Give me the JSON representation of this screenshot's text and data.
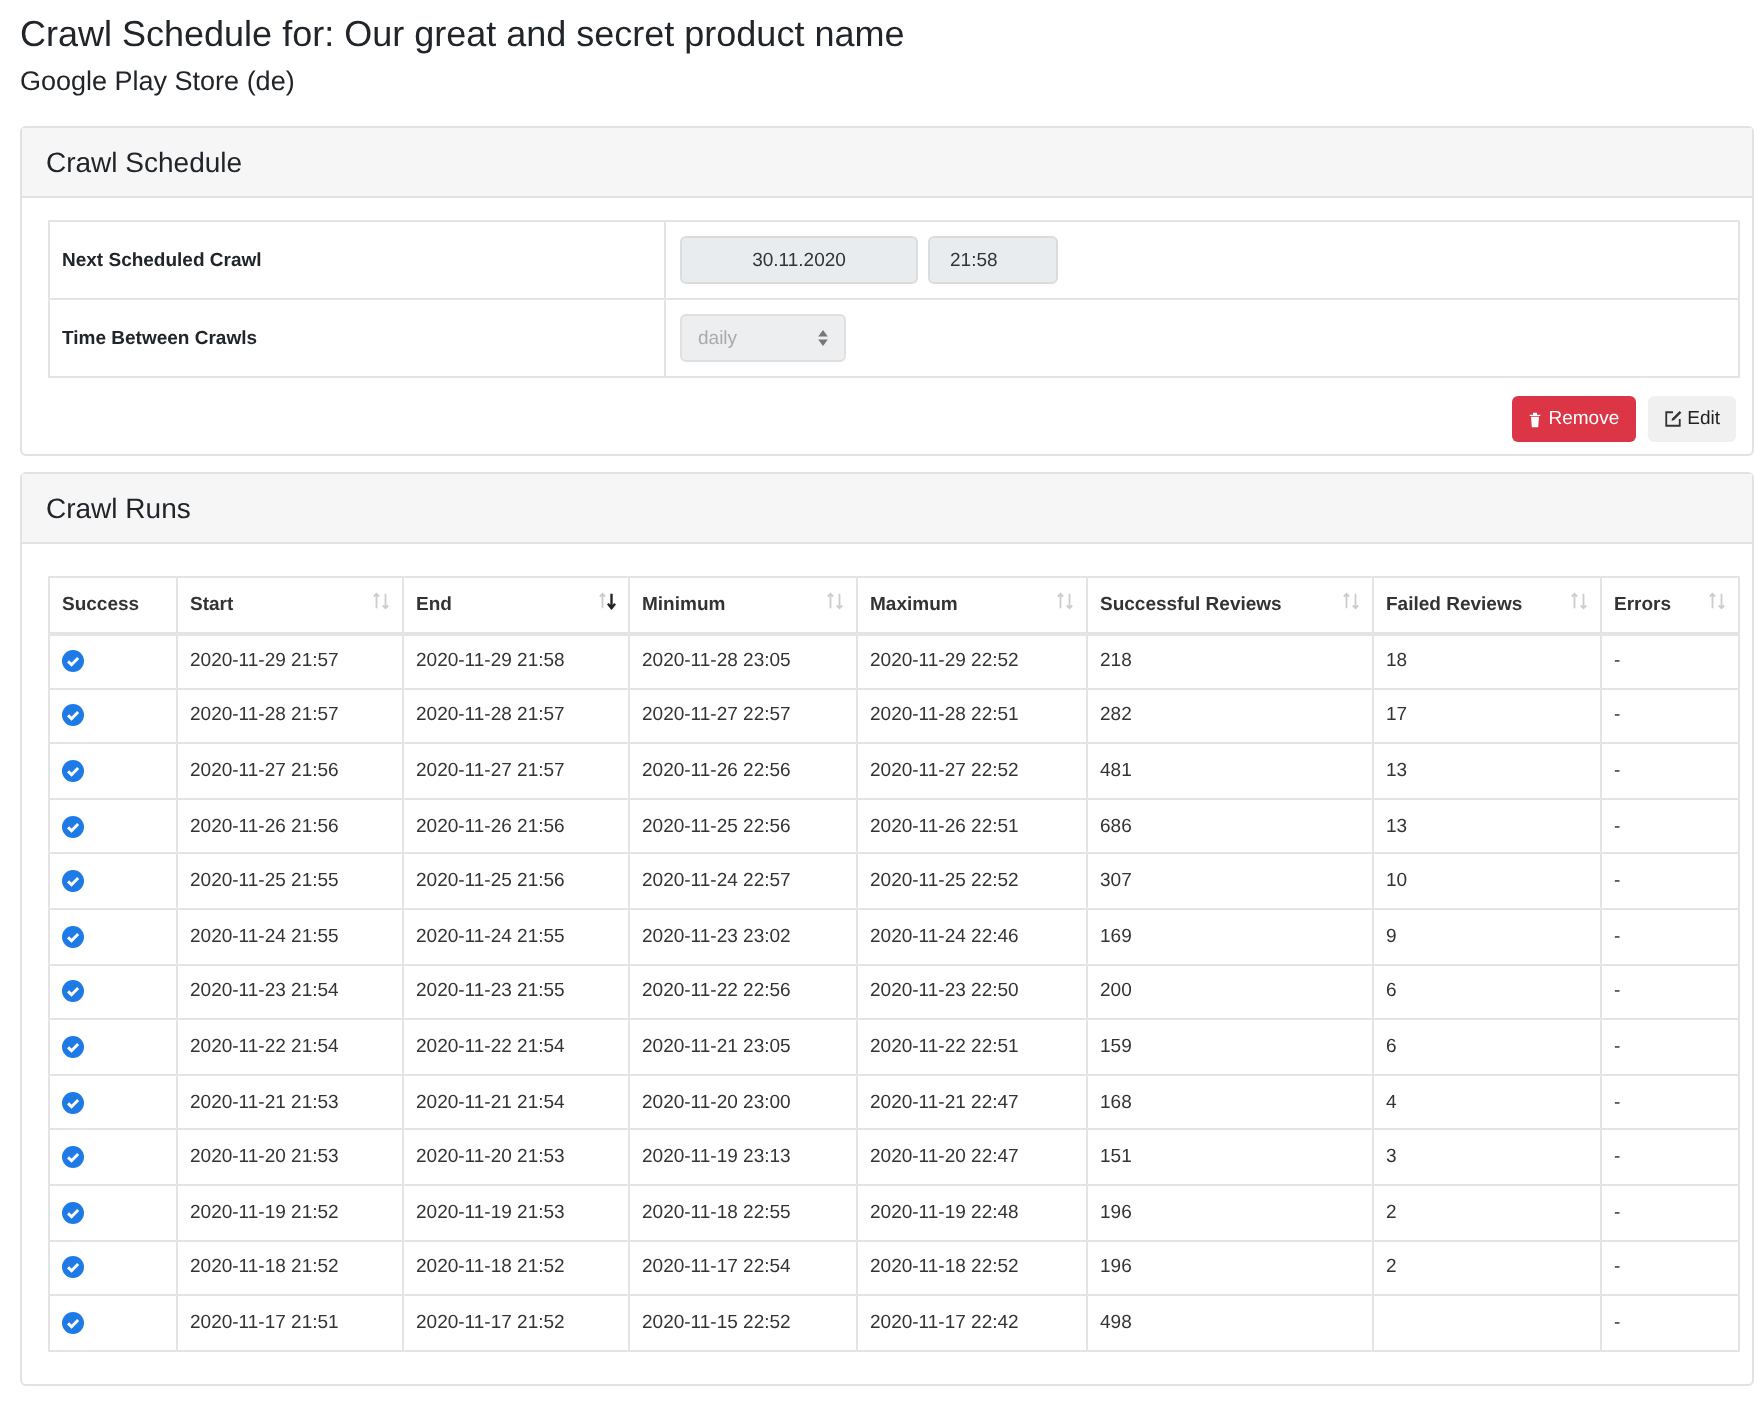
{
  "title": "Crawl Schedule for: Our great and secret product name",
  "subtitle": "Google Play Store (de)",
  "schedule": {
    "heading": "Crawl Schedule",
    "rows": [
      {
        "label": "Next Scheduled Crawl",
        "kind": "datetime",
        "date": "30.11.2020",
        "time": "21:58"
      },
      {
        "label": "Time Between Crawls",
        "kind": "select",
        "value": "daily",
        "disabled": true
      }
    ],
    "buttons": [
      {
        "label": "Remove",
        "kind": "danger"
      },
      {
        "label": "Edit",
        "kind": "light"
      }
    ]
  },
  "runs": {
    "heading": "Crawl Runs",
    "columns": [
      {
        "label": "Success",
        "sortable": false
      },
      {
        "label": "Start",
        "sortable": true,
        "sorted": false
      },
      {
        "label": "End",
        "sortable": true,
        "sorted": true
      },
      {
        "label": "Minimum",
        "sortable": true,
        "sorted": false
      },
      {
        "label": "Maximum",
        "sortable": true,
        "sorted": false
      },
      {
        "label": "Successful Reviews",
        "sortable": true,
        "sorted": false
      },
      {
        "label": "Failed Reviews",
        "sortable": true,
        "sorted": false
      },
      {
        "label": "Errors",
        "sortable": true,
        "sorted": false
      }
    ],
    "rows": [
      {
        "success": true,
        "cells": [
          "",
          "2020-11-29 21:57",
          "2020-11-29 21:58",
          "2020-11-28 23:05",
          "2020-11-29 22:52",
          "218",
          "18",
          "-"
        ]
      },
      {
        "success": true,
        "cells": [
          "",
          "2020-11-28 21:57",
          "2020-11-28 21:57",
          "2020-11-27 22:57",
          "2020-11-28 22:51",
          "282",
          "17",
          "-"
        ]
      },
      {
        "success": true,
        "cells": [
          "",
          "2020-11-27 21:56",
          "2020-11-27 21:57",
          "2020-11-26 22:56",
          "2020-11-27 22:52",
          "481",
          "13",
          "-"
        ]
      },
      {
        "success": true,
        "cells": [
          "",
          "2020-11-26 21:56",
          "2020-11-26 21:56",
          "2020-11-25 22:56",
          "2020-11-26 22:51",
          "686",
          "13",
          "-"
        ]
      },
      {
        "success": true,
        "cells": [
          "",
          "2020-11-25 21:55",
          "2020-11-25 21:56",
          "2020-11-24 22:57",
          "2020-11-25 22:52",
          "307",
          "10",
          "-"
        ]
      },
      {
        "success": true,
        "cells": [
          "",
          "2020-11-24 21:55",
          "2020-11-24 21:55",
          "2020-11-23 23:02",
          "2020-11-24 22:46",
          "169",
          "9",
          "-"
        ]
      },
      {
        "success": true,
        "cells": [
          "",
          "2020-11-23 21:54",
          "2020-11-23 21:55",
          "2020-11-22 22:56",
          "2020-11-23 22:50",
          "200",
          "6",
          "-"
        ]
      },
      {
        "success": true,
        "cells": [
          "",
          "2020-11-22 21:54",
          "2020-11-22 21:54",
          "2020-11-21 23:05",
          "2020-11-22 22:51",
          "159",
          "6",
          "-"
        ]
      },
      {
        "success": true,
        "cells": [
          "",
          "2020-11-21 21:53",
          "2020-11-21 21:54",
          "2020-11-20 23:00",
          "2020-11-21 22:47",
          "168",
          "4",
          "-"
        ]
      },
      {
        "success": true,
        "cells": [
          "",
          "2020-11-20 21:53",
          "2020-11-20 21:53",
          "2020-11-19 23:13",
          "2020-11-20 22:47",
          "151",
          "3",
          "-"
        ]
      },
      {
        "success": true,
        "cells": [
          "",
          "2020-11-19 21:52",
          "2020-11-19 21:53",
          "2020-11-18 22:55",
          "2020-11-19 22:48",
          "196",
          "2",
          "-"
        ]
      },
      {
        "success": true,
        "cells": [
          "",
          "2020-11-18 21:52",
          "2020-11-18 21:52",
          "2020-11-17 22:54",
          "2020-11-18 22:52",
          "196",
          "2",
          "-"
        ]
      },
      {
        "success": true,
        "cells": [
          "",
          "2020-11-17 21:51",
          "2020-11-17 21:52",
          "2020-11-15 22:52",
          "2020-11-17 22:42",
          "498",
          "",
          "-"
        ]
      }
    ]
  }
}
